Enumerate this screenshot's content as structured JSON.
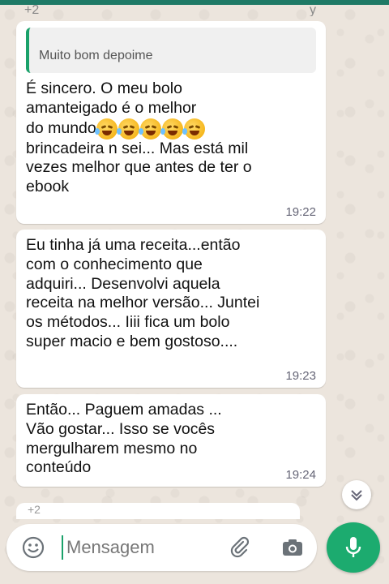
{
  "top_fragment": {
    "left": "+2",
    "right": "y"
  },
  "messages": [
    {
      "quote": {
        "author": "",
        "text": "Muito bom depoime"
      },
      "lines_before": "É sincero. O meu bolo\namanteigado é o melhor",
      "emoji_line_text": "do mundo",
      "emoji_count": 5,
      "emoji_name": "rolling-on-floor-laughing",
      "lines_after": "brincadeira n sei... Mas está mil\nvezes melhor que antes de ter o\nebook",
      "time": "19:22"
    },
    {
      "text": "Eu tinha já uma receita...então\ncom o conhecimento que\nadquiri... Desenvolvi aquela\nreceita na melhor versão... Juntei\nos métodos... Iiii fica um bolo\nsuper macio e bem gostoso....",
      "time": "19:23"
    },
    {
      "text": "Então... Paguem amadas ...\nVão gostar... Isso se vocês\nmergulharem mesmo no\nconteúdo",
      "time": "19:24"
    }
  ],
  "partial_next": {
    "text": "+2"
  },
  "composer": {
    "placeholder": "Mensagem",
    "icons": [
      "emoji-icon",
      "paperclip-icon",
      "camera-icon",
      "microphone-icon"
    ]
  },
  "colors": {
    "accent": "#1cab6f",
    "bubble": "#ffffff",
    "wallpaper": "#ece5dd",
    "quote_bar": "#1aa16a"
  }
}
